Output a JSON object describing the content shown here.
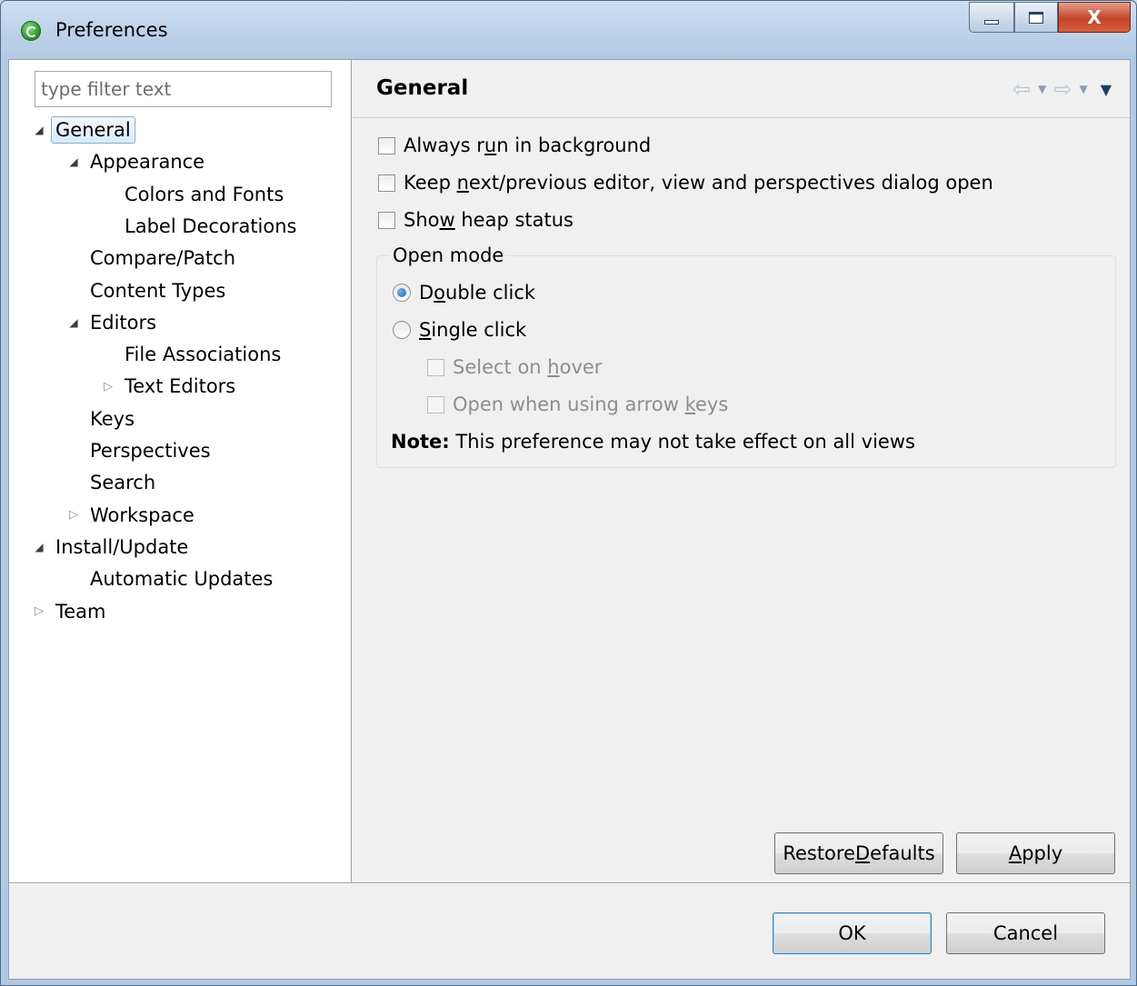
{
  "window": {
    "title": "Preferences",
    "controls": {
      "minimize": "minimize",
      "maximize": "maximize",
      "close": "X"
    }
  },
  "filter": {
    "placeholder": "type filter text",
    "value": ""
  },
  "tree": [
    {
      "label": "General",
      "level": 0,
      "state": "expanded",
      "selected": true
    },
    {
      "label": "Appearance",
      "level": 1,
      "state": "expanded"
    },
    {
      "label": "Colors and Fonts",
      "level": 2,
      "state": "leaf"
    },
    {
      "label": "Label Decorations",
      "level": 2,
      "state": "leaf"
    },
    {
      "label": "Compare/Patch",
      "level": 1,
      "state": "leaf"
    },
    {
      "label": "Content Types",
      "level": 1,
      "state": "leaf"
    },
    {
      "label": "Editors",
      "level": 1,
      "state": "expanded"
    },
    {
      "label": "File Associations",
      "level": 2,
      "state": "leaf"
    },
    {
      "label": "Text Editors",
      "level": 2,
      "state": "collapsed"
    },
    {
      "label": "Keys",
      "level": 1,
      "state": "leaf"
    },
    {
      "label": "Perspectives",
      "level": 1,
      "state": "leaf"
    },
    {
      "label": "Search",
      "level": 1,
      "state": "leaf"
    },
    {
      "label": "Workspace",
      "level": 1,
      "state": "collapsed"
    },
    {
      "label": "Install/Update",
      "level": 0,
      "state": "expanded"
    },
    {
      "label": "Automatic Updates",
      "level": 1,
      "state": "leaf"
    },
    {
      "label": "Team",
      "level": 0,
      "state": "collapsed"
    }
  ],
  "page": {
    "title": "General",
    "nav": {
      "back": "back-arrow",
      "forward": "forward-arrow",
      "menu": "view-menu"
    }
  },
  "options": {
    "always_run": {
      "pre": "Always r",
      "u": "u",
      "post": "n in background",
      "checked": false
    },
    "keep_next": {
      "pre": "Keep ",
      "u": "n",
      "post": "ext/previous editor, view and perspectives dialog open",
      "checked": false
    },
    "show_heap": {
      "pre": "Sho",
      "u": "w",
      "post": " heap status",
      "checked": false
    }
  },
  "open_mode": {
    "legend": "Open mode",
    "double_click": {
      "pre": "D",
      "u": "o",
      "post": "uble click",
      "selected": true
    },
    "single_click": {
      "pre": "",
      "u": "S",
      "post": "ingle click",
      "selected": false
    },
    "select_on_hover": {
      "pre": "Select on ",
      "u": "h",
      "post": "over",
      "checked": false,
      "enabled": false
    },
    "open_arrow": {
      "pre": "Open when using arrow ",
      "u": "k",
      "post": "eys",
      "checked": false,
      "enabled": false
    },
    "note_label": "Note:",
    "note_text": "This preference may not take effect on all views"
  },
  "buttons": {
    "restore": {
      "pre": "Restore ",
      "u": "D",
      "post": "efaults"
    },
    "apply": {
      "pre": "",
      "u": "A",
      "post": "pply"
    },
    "ok": "OK",
    "cancel": "Cancel"
  }
}
